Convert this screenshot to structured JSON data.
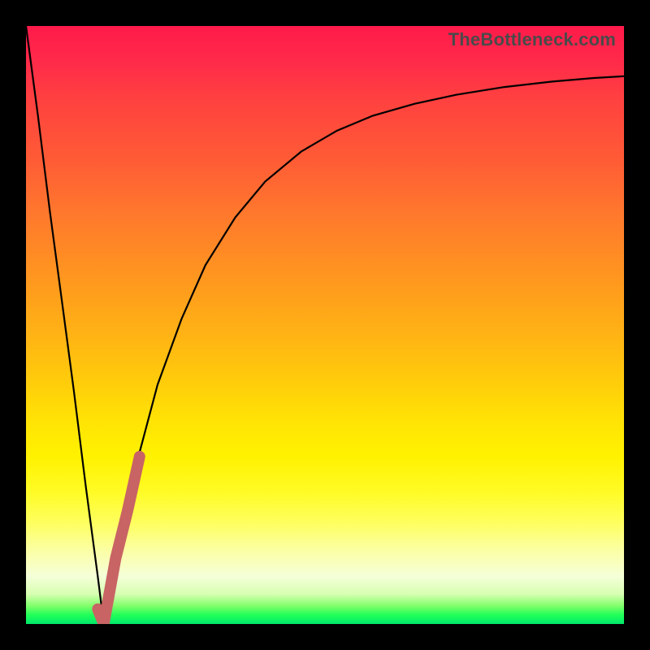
{
  "watermark": "TheBottleneck.com",
  "chart_data": {
    "type": "line",
    "title": "",
    "xlabel": "",
    "ylabel": "",
    "xlim": [
      0,
      100
    ],
    "ylim": [
      0,
      100
    ],
    "grid": false,
    "legend": false,
    "series": [
      {
        "name": "left-curve",
        "stroke": "#000000",
        "x": [
          0,
          2,
          4,
          6,
          8,
          10,
          12,
          13
        ],
        "values": [
          100,
          85,
          69,
          54,
          39,
          23,
          8,
          0
        ]
      },
      {
        "name": "right-curve",
        "stroke": "#000000",
        "x": [
          13,
          15,
          18,
          22,
          26,
          30,
          35,
          40,
          46,
          52,
          58,
          65,
          72,
          80,
          88,
          95,
          100
        ],
        "values": [
          0,
          11,
          25,
          40,
          51,
          60,
          68,
          74,
          79,
          82.5,
          85,
          87,
          88.5,
          89.8,
          90.7,
          91.3,
          91.6
        ]
      },
      {
        "name": "highlight-segment",
        "stroke": "#c86464",
        "x": [
          12.0,
          13.0,
          15.0,
          17.0,
          19.0
        ],
        "values": [
          2.5,
          0.0,
          11.0,
          19.0,
          28.0
        ]
      }
    ],
    "background_gradient": {
      "stops": [
        {
          "pos": 0,
          "color": "#ff1a4a"
        },
        {
          "pos": 50,
          "color": "#ffb414"
        },
        {
          "pos": 75,
          "color": "#fff200"
        },
        {
          "pos": 100,
          "color": "#00e86a"
        }
      ]
    }
  }
}
